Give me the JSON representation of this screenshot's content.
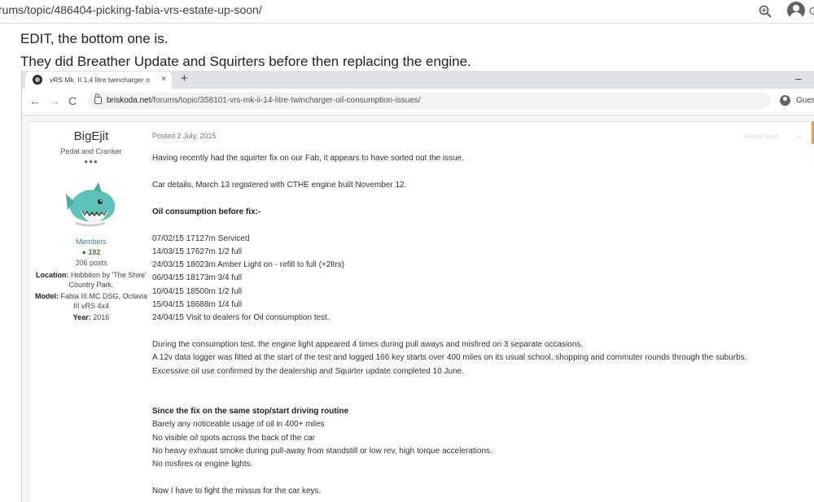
{
  "outer_browser": {
    "url": "rums/topic/486404-picking-fabia-vrs-estate-up-soon/",
    "profile_letter": "G"
  },
  "forum_post": {
    "line1": "EDIT, the bottom one is.",
    "line2": "They did Breather Update and Squirters before then replacing the engine."
  },
  "embedded_browser": {
    "tab_title": "vRS Mk. II 1.4 litre twincharger o",
    "tab_close": "×",
    "new_tab": "+",
    "minimize": "–",
    "url_domain": "briskoda.net",
    "url_path": "/forums/topic/358101-vrs-mk-ii-14-litre-twincharger-oil-consumption-issues/",
    "guest_label": "Gues",
    "back": "←",
    "forward": "→",
    "reload": "C"
  },
  "author": {
    "name": "BigEjit",
    "title": "Pedal and Cranker",
    "rank_dots": "●●●",
    "group": "Members",
    "reputation": "182",
    "posts": "306 posts",
    "location_label": "Location:",
    "location_value": "Hobbiton by 'The Shire' Country Park.",
    "model_label": "Model:",
    "model_value": "Fabia III MC DSG, Octavia III vRS 4x4",
    "year_label": "Year:",
    "year_value": "2016"
  },
  "post": {
    "date": "Posted 2 July, 2015",
    "ghost_text": "Report post",
    "share": "<",
    "lines": [
      {
        "text": "Having recently had the squirter fix on our Fab, it appears to have sorted out the issue.",
        "bold": false
      },
      {
        "text": "Car details, March 13 registered with CTHE engine built November 12.",
        "bold": false
      },
      {
        "text": "Oil consumption before fix:-",
        "bold": true
      },
      {
        "text": "07/02/15 17127m Serviced",
        "bold": false
      },
      {
        "text": "14/03/15 17627m 1/2 full",
        "bold": false
      },
      {
        "text": "24/03/15 18023m Amber Light on - refill to full (+2ltrs)",
        "bold": false
      },
      {
        "text": "06/04/15 18173m 3/4 full",
        "bold": false
      },
      {
        "text": "10/04/15 18500m 1/2 full",
        "bold": false
      },
      {
        "text": "15/04/15 18688m 1/4 full",
        "bold": false
      },
      {
        "text": "24/04/15 Visit to dealers for Oil consumption test.",
        "bold": false
      },
      {
        "text": "During the consumption test, the engine light appeared 4 times during pull aways and misfired on 3 separate occasions.",
        "bold": false
      },
      {
        "text": "A 12v data logger was fitted at the start of the test and logged 166 key starts over 400 miles on its usual school, shopping and commuter rounds through the suburbs.",
        "bold": false
      },
      {
        "text": "Excessive oil use confirmed by the dealership and Squirter update completed 10 June.",
        "bold": false
      },
      {
        "text": "Since the fix on the same stop/start driving routine",
        "bold": true
      },
      {
        "text": "Barely any noticeable usage of oil in 400+ miles",
        "bold": false
      },
      {
        "text": "No visible oil spots across the back of the car",
        "bold": false
      },
      {
        "text": "No heavy exhaust smoke during pull-away from standstill or low rev, high torque accelerations.",
        "bold": false
      },
      {
        "text": "No misfires or engine lights.",
        "bold": false
      },
      {
        "text": "Now I have to fight the missus for the car keys.",
        "bold": false
      }
    ]
  }
}
